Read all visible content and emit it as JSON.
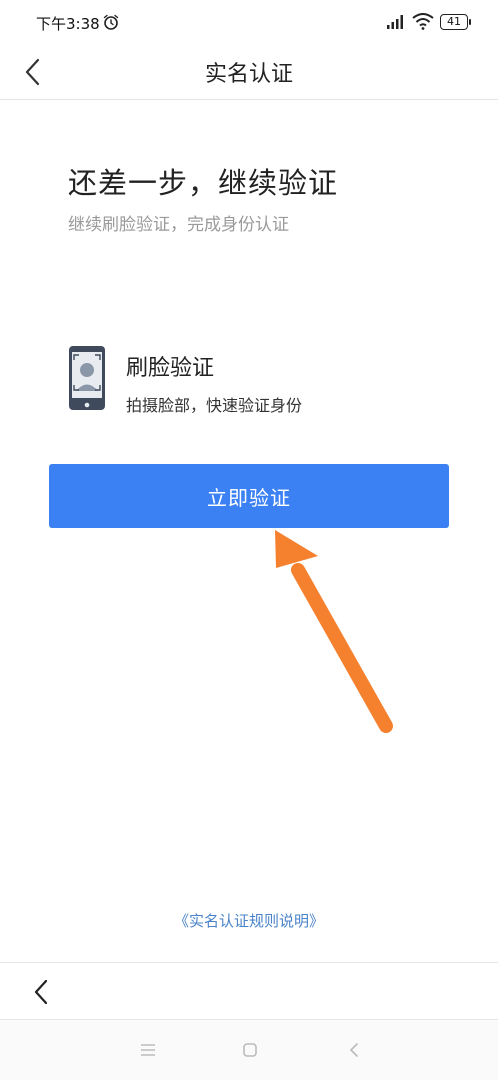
{
  "status_bar": {
    "time": "下午3:38",
    "battery": "41"
  },
  "nav": {
    "title": "实名认证"
  },
  "content": {
    "headline": "还差一步，继续验证",
    "subline": "继续刷脸验证，完成身份认证",
    "method": {
      "title": "刷脸验证",
      "description": "拍摄脸部，快速验证身份",
      "icon": "phone-face-scan-icon"
    },
    "verify_button": "立即验证",
    "rules_link": "《实名认证规则说明》"
  },
  "colors": {
    "primary": "#3b81f4",
    "annotation_arrow": "#f5802e",
    "link": "#4a83c9"
  }
}
